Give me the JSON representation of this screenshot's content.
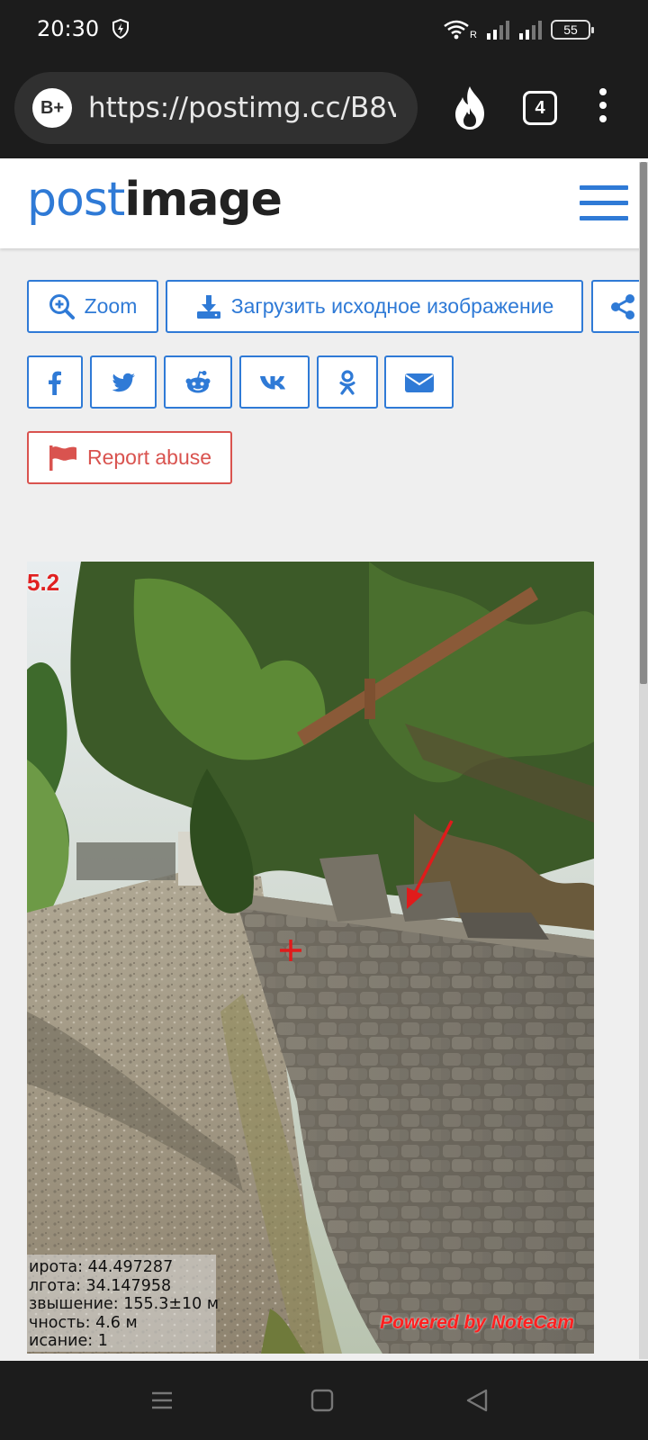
{
  "status": {
    "time": "20:30",
    "battery": "55",
    "network_label": "R"
  },
  "browser": {
    "badge": "B+",
    "url": "https://postimg.cc/B8v",
    "tab_count": "4"
  },
  "site": {
    "logo_post": "post",
    "logo_image": "image"
  },
  "actions": {
    "zoom_label": "Zoom",
    "download_label": "Загрузить исходное изображение",
    "report_label": "Report abuse"
  },
  "social": [
    "facebook",
    "twitter",
    "reddit",
    "vk",
    "odnoklassniki",
    "email"
  ],
  "photo": {
    "corner_text": "5.2",
    "info": [
      "ирота: 44.497287",
      "лгота: 34.147958",
      "звышение: 155.3±10 м",
      "чность: 4.6 м",
      "исание: 1"
    ],
    "credit": "Powered by NoteCam"
  },
  "colors": {
    "accent": "#2f7ad6",
    "report": "#d9534f",
    "chrome": "#1c1c1c"
  }
}
